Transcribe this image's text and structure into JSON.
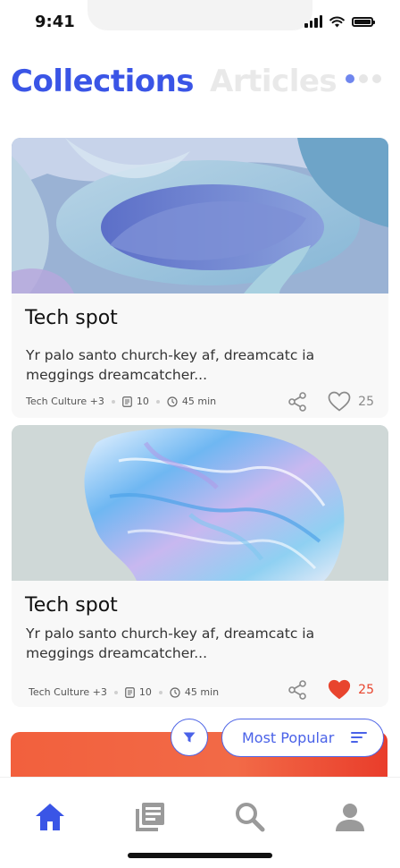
{
  "status_bar": {
    "time": "9:41"
  },
  "tabs": [
    {
      "label": "Collections",
      "active": true
    },
    {
      "label": "Articles",
      "active": false
    }
  ],
  "page_indicator": {
    "total": 3,
    "current": 1
  },
  "cards": [
    {
      "title": "Tech spot",
      "description": "Yr palo santo church-key af, dreamcatc ia meggings dreamcatcher...",
      "tag": "Tech Culture +3",
      "count": "10",
      "duration": "45 min",
      "likes": "25",
      "liked": false
    },
    {
      "title": "Tech spot",
      "description": "Yr palo santo church-key af, dreamcatc ia meggings dreamcatcher...",
      "tag": "Tech Culture +3",
      "count": "10",
      "duration": "45 min",
      "likes": "25",
      "liked": true
    }
  ],
  "sort": {
    "label": "Most Popular"
  },
  "bottom_nav": [
    {
      "icon": "home-icon",
      "active": true
    },
    {
      "icon": "articles-icon",
      "active": false
    },
    {
      "icon": "search-icon",
      "active": false
    },
    {
      "icon": "profile-icon",
      "active": false
    }
  ],
  "colors": {
    "accent": "#3a55e6",
    "like": "#e8452e",
    "inactive_icon": "#9a9a9a"
  }
}
